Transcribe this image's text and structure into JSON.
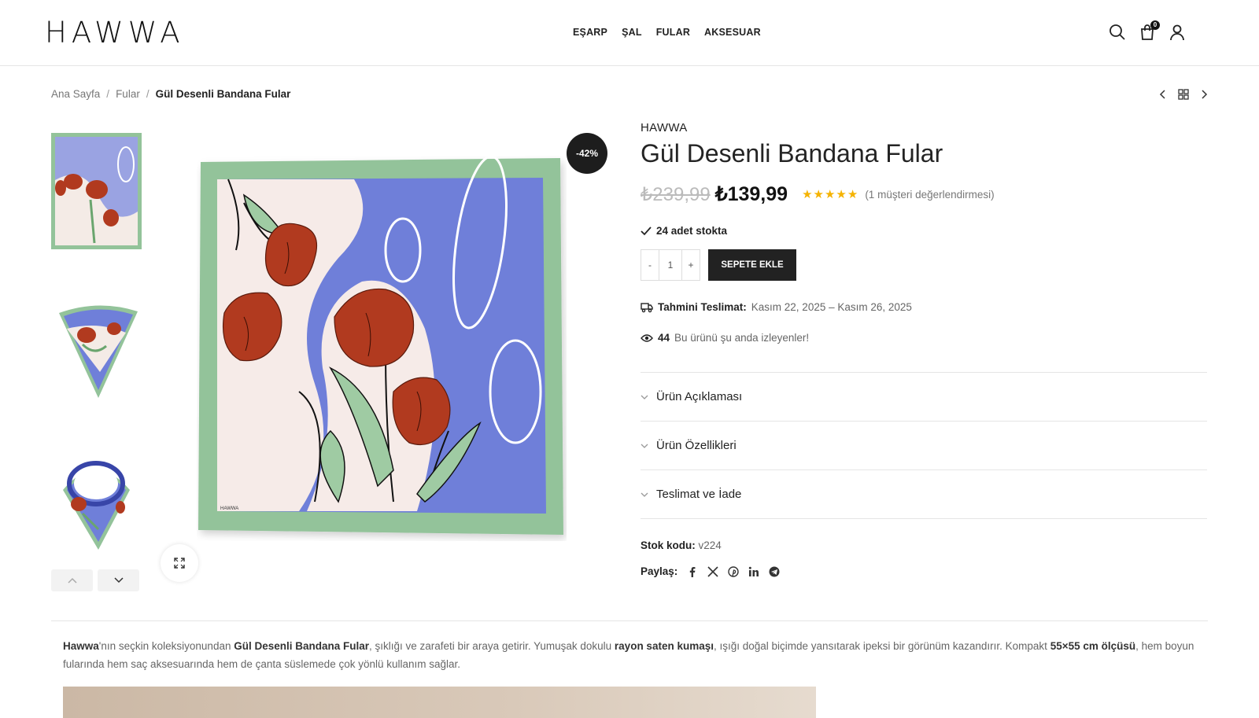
{
  "header": {
    "logo": "HAWWA",
    "nav": [
      "EŞARP",
      "ŞAL",
      "FULAR",
      "AKSESUAR"
    ],
    "cart_count": "0"
  },
  "breadcrumb": {
    "items": [
      "Ana Sayfa",
      "Fular"
    ],
    "separator": "/",
    "current": "Gül Desenli Bandana Fular"
  },
  "gallery": {
    "discount_badge": "-42%"
  },
  "product": {
    "brand": "HAWWA",
    "title": "Gül Desenli Bandana Fular",
    "old_price": "₺239,99",
    "new_price": "₺139,99",
    "rating": 5,
    "stars": "★★★★★",
    "reviews": "(1 müşteri değerlendirmesi)",
    "stock": "24 adet stokta",
    "qty_minus": "-",
    "qty_value": "1",
    "qty_plus": "+",
    "add_to_cart": "SEPETE EKLE",
    "delivery_label": "Tahmini Teslimat:",
    "delivery_value": "Kasım 22, 2025 – Kasım 26, 2025",
    "viewers_count": "44",
    "viewers_text": "Bu ürünü şu anda izleyenler!",
    "accordion": [
      "Ürün Açıklaması",
      "Ürün Özellikleri",
      "Teslimat ve İade"
    ],
    "sku_label": "Stok kodu:",
    "sku_value": "v224",
    "share_label": "Paylaş:"
  },
  "description": {
    "p1": "Hawwa",
    "p2": "'nın seçkin koleksiyonundan ",
    "p3": "Gül Desenli Bandana Fular",
    "p4": ", şıklığı ve zarafeti bir araya getirir. Yumuşak dokulu ",
    "p5": "rayon saten kumaşı",
    "p6": ", ışığı doğal biçimde yansıtarak ipeksi bir görünüm kazandırır. Kompakt ",
    "p7": "55×55 cm ölçüsü",
    "p8": ", hem boyun fularında hem saç aksesuarında hem de çanta süslemede çok yönlü kullanım sağlar."
  },
  "colors": {
    "blue": "#6f7fd9",
    "green": "#93c39a",
    "red": "#b13a1f",
    "dark": "#222222",
    "star": "#f5b301"
  }
}
